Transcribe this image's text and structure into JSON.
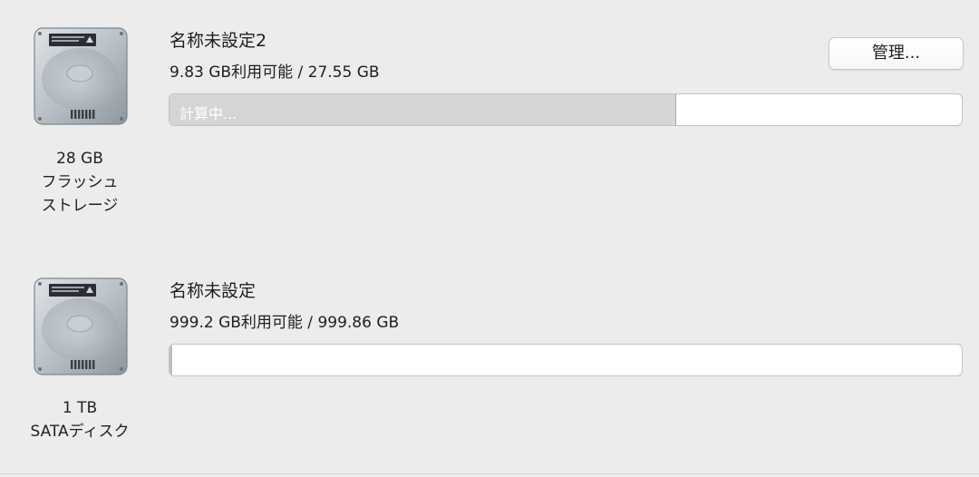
{
  "disks": [
    {
      "icon": "hard-drive-icon",
      "size": "28 GB",
      "type_line1": "フラッシュ",
      "type_line2": "ストレージ",
      "volume_name": "名称未設定2",
      "capacity_text": "9.83 GB利用可能 / 27.55 GB",
      "bar_label": "計算中...",
      "used_fraction": 0.64,
      "has_manage_button": true
    },
    {
      "icon": "hard-drive-icon",
      "size": "1 TB",
      "type_line1": "SATAディスク",
      "type_line2": "",
      "volume_name": "名称未設定",
      "capacity_text": "999.2 GB利用可能 / 999.86 GB",
      "bar_label": "",
      "used_fraction": 0.0007,
      "has_manage_button": false
    }
  ],
  "manage_button": {
    "label": "管理..."
  },
  "colors": {
    "background": "#ececec",
    "bar_empty": "#ffffff",
    "bar_calculating": "#d5d5d5"
  }
}
